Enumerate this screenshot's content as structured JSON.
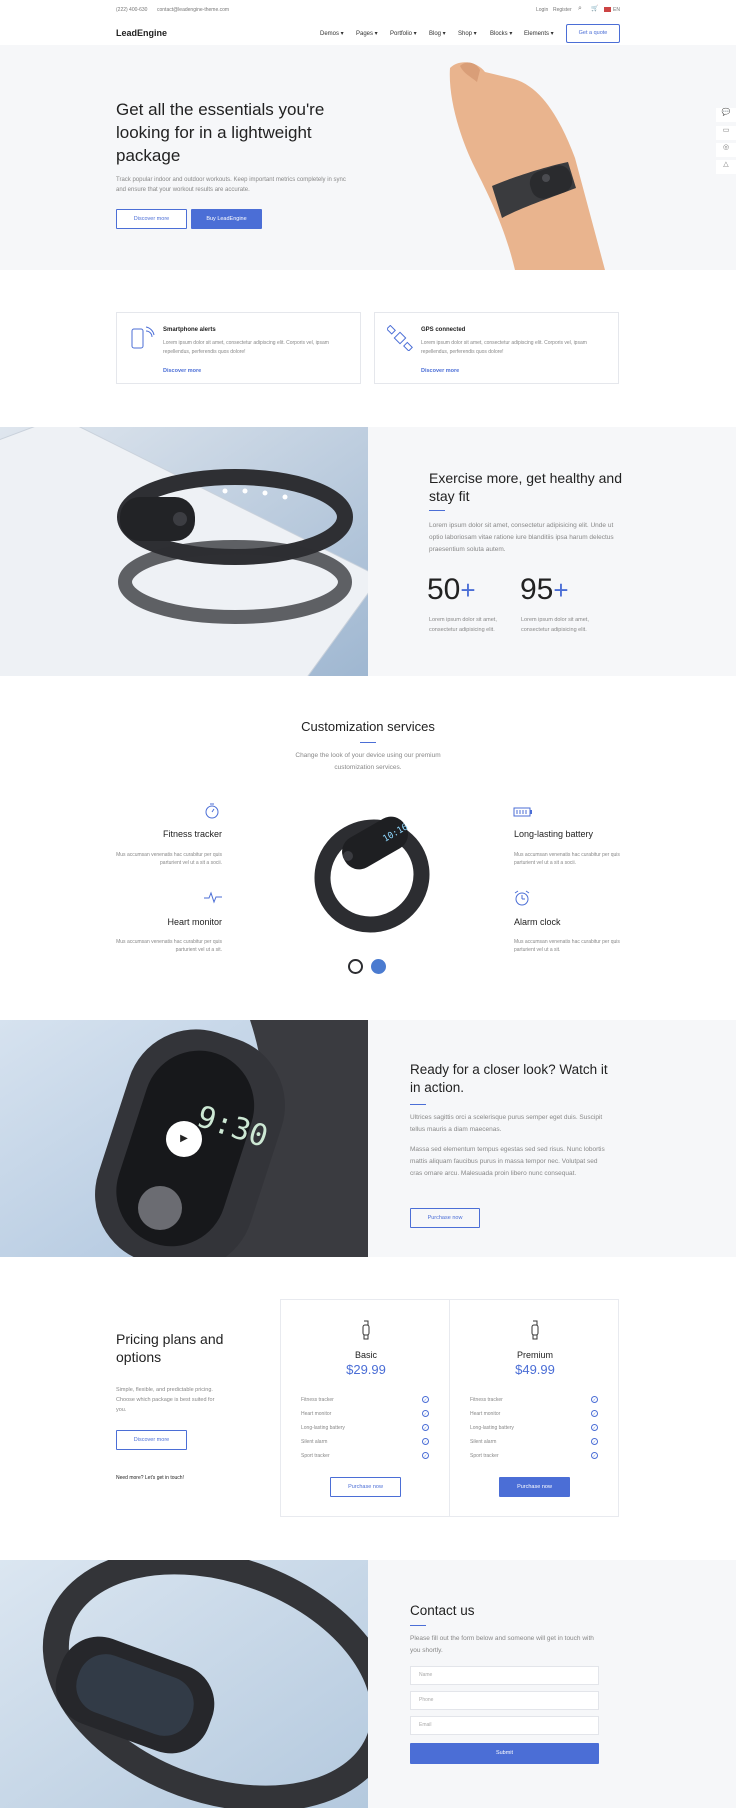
{
  "topbar": {
    "phone": "(222) 400-630",
    "email": "contact@leadengine-theme.com",
    "login": "Login",
    "register": "Register",
    "lang": "EN"
  },
  "nav": {
    "logo": "LeadEngine",
    "items": [
      "Demos",
      "Pages",
      "Portfolio",
      "Blog",
      "Shop",
      "Blocks",
      "Elements"
    ],
    "cta": "Get a quote"
  },
  "hero": {
    "title": "Get all the essentials you're looking for in a lightweight package",
    "text": "Track popular indoor and outdoor workouts. Keep important metrics completely in sync and ensure that your workout results are accurate.",
    "btn_discover": "Discover more",
    "btn_buy": "Buy LeadEngine"
  },
  "cards": [
    {
      "title": "Smartphone alerts",
      "text": "Lorem ipsum dolor sit amet, consectetur adipiscing elit. Corporis vel, ipsam repellendus, perferendis quos dolore!",
      "link": "Discover more"
    },
    {
      "title": "GPS connected",
      "text": "Lorem ipsum dolor sit amet, consectetur adipiscing elit. Corporis vel, ipsam repellendus, perferendis quos dolore!",
      "link": "Discover more"
    }
  ],
  "exercise": {
    "title": "Exercise more, get healthy and stay fit",
    "text": "Lorem ipsum dolor sit amet, consectetur adipisicing elit. Unde ut optio laboriosam vitae ratione iure blanditiis ipsa harum delectus praesentium soluta autem.",
    "stats": [
      {
        "value": "50",
        "suffix": "+",
        "text": "Lorem ipsum dolor sit amet, consectetur adipisicing elit."
      },
      {
        "value": "95",
        "suffix": "+",
        "text": "Lorem ipsum dolor sit amet, consectetur adipisicing elit."
      }
    ]
  },
  "custom": {
    "title": "Customization services",
    "subtitle": "Change the look of your device using our premium customization services.",
    "features": [
      {
        "title": "Fitness tracker",
        "text": "Mus accumsan venenatis hac curabitur per quis parturient vel ut a sit a socii."
      },
      {
        "title": "Heart monitor",
        "text": "Mus accumsan venenatis hac curabitur per quis parturient vel ut a sit."
      },
      {
        "title": "Long-lasting battery",
        "text": "Mus accumsan venenatis hac curabitur per quis parturient vel ut a sit a socii."
      },
      {
        "title": "Alarm clock",
        "text": "Mus accumsan venenatis hac curabitur per quis parturient vel ut a sit."
      }
    ]
  },
  "video": {
    "title": "Ready for a closer look? Watch it in action.",
    "text1": "Ultrices sagittis orci a scelerisque purus semper eget duis. Suscipit tellus mauris a diam maecenas.",
    "text2": "Massa sed elementum tempus egestas sed sed risus. Nunc lobortis mattis aliquam faucibus purus in massa tempor nec. Volutpat sed cras ornare arcu. Malesuada proin libero nunc consequat.",
    "button": "Purchase now",
    "watch_time": "9:30"
  },
  "pricing": {
    "title": "Pricing plans and options",
    "text": "Simple, flexible, and predictable pricing. Choose which package is best suited for you.",
    "button": "Discover more",
    "note": "Need more? Let's get in touch!",
    "plans": [
      {
        "name": "Basic",
        "price": "$29.99",
        "features": [
          "Fitness tracker",
          "Heart monitor",
          "Long-lasting battery",
          "Silent alarm",
          "Sport tracker"
        ],
        "button": "Purchase now"
      },
      {
        "name": "Premium",
        "price": "$49.99",
        "features": [
          "Fitness tracker",
          "Heart monitor",
          "Long-lasting battery",
          "Silent alarm",
          "Sport tracker"
        ],
        "button": "Purchase now"
      }
    ]
  },
  "contact": {
    "title": "Contact us",
    "text": "Please fill out the form below and someone will get in touch with you shortly.",
    "fields": {
      "name": "Name",
      "phone": "Phone",
      "email": "Email"
    },
    "submit": "Submit"
  },
  "colors": {
    "accent": "#4b6ed6",
    "grey_bg": "#f6f7f9"
  }
}
